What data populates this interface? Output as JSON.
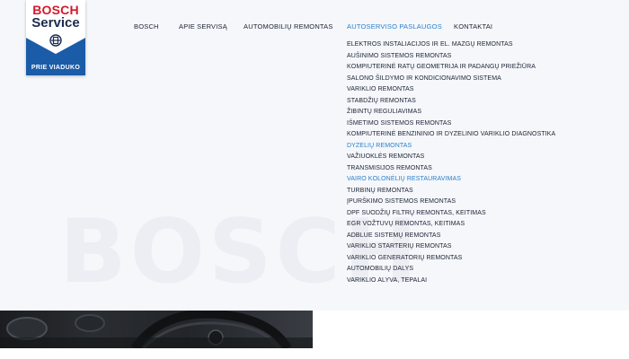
{
  "logo": {
    "brand": "BOSCH",
    "service": "Service",
    "location": "PRIE VIADUKO"
  },
  "watermark": "BOSCH",
  "nav": {
    "items": [
      {
        "label": "BOSCH"
      },
      {
        "label": "APIE SERVISĄ"
      },
      {
        "label": "AUTOMOBILIŲ REMONTAS"
      },
      {
        "label": "AUTOSERVISO PASLAUGOS"
      },
      {
        "label": "KONTAKTAI"
      }
    ],
    "active": "AUTOSERVISO PASLAUGOS"
  },
  "dropdown": {
    "items": [
      "ELEKTROS INSTALIACIJOS IR EL. MAZGŲ REMONTAS",
      "AUŠINIMO SISTEMOS REMONTAS",
      "KOMPIUTERINĖ RATŲ GEOMETRIJA IR PADANGŲ PRIEŽIŪRA",
      "SALONO ŠILDYMO IR KONDICIONAVIMO SISTEMA",
      "VARIKLIO REMONTAS",
      "STABDŽIŲ REMONTAS",
      "ŽIBINTŲ REGULIAVIMAS",
      "IŠMETIMO SISTEMOS REMONTAS",
      "KOMPIUTERINĖ BENZININIO IR DYZELINIO VARIKLIO DIAGNOSTIKA",
      "DYZELIŲ REMONTAS",
      "VAŽIUOKLĖS REMONTAS",
      "TRANSMISIJOS REMONTAS",
      "VAIRO KOLONĖLIŲ RESTAURAVIMAS",
      "TURBINŲ REMONTAS",
      "ĮPURŠKIMO SISTEMOS REMONTAS",
      "DPF SUODŽIŲ FILTRŲ REMONTAS, KEITIMAS",
      "EGR VOŽTUVŲ REMONTAS, KEITIMAS",
      "ADBLUE SISTEMŲ REMONTAS",
      "VARIKLIO STARTERIŲ REMONTAS",
      "VARIKLIO GENERATORIŲ REMONTAS",
      "AUTOMOBILIŲ DALYS",
      "VARIKLIO ALYVA, TEPALAI"
    ],
    "highlighted": [
      "DYZELIŲ REMONTAS",
      "VAIRO KOLONĖLIŲ RESTAURAVIMAS"
    ]
  },
  "colors": {
    "accent": "#2a7fc9",
    "brand_red": "#d2192b",
    "brand_blue": "#1a5ca8",
    "text": "#1a2233"
  },
  "icons": {
    "logo_emblem": "bosch-armature-icon"
  }
}
